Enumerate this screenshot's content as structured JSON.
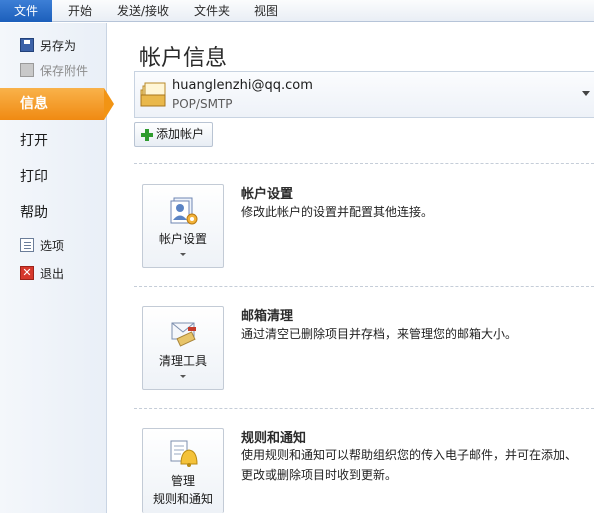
{
  "ribbon": {
    "tabs": [
      "文件",
      "开始",
      "发送/接收",
      "文件夹",
      "视图"
    ]
  },
  "nav": {
    "save_as": "另存为",
    "save_attachments": "保存附件",
    "info": "信息",
    "open": "打开",
    "print": "打印",
    "help": "帮助",
    "options": "选项",
    "exit": "退出"
  },
  "main": {
    "title": "帐户信息",
    "account": {
      "email": "huanglenzhi@qq.com",
      "protocol": "POP/SMTP"
    },
    "add_account_label": "添加帐户",
    "sections": [
      {
        "button_label": "帐户设置",
        "title": "帐户设置",
        "description": "修改此帐户的设置并配置其他连接。"
      },
      {
        "button_label": "清理工具",
        "title": "邮箱清理",
        "description": "通过清空已删除项目并存档，来管理您的邮箱大小。"
      },
      {
        "button_label_line1": "管理",
        "button_label_line2": "规则和通知",
        "title": "规则和通知",
        "description_line1": "使用规则和通知可以帮助组织您的传入电子邮件，并可在添加、",
        "description_line2": "更改或删除项目时收到更新。"
      }
    ]
  },
  "colors": {
    "file_tab": "#1c5fbb",
    "active_nav": "#f29414",
    "add_icon": "#2e9b2e"
  }
}
